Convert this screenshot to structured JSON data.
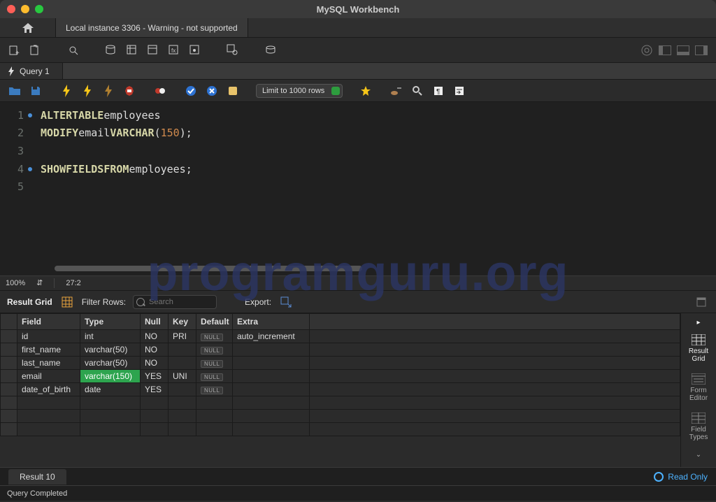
{
  "window": {
    "title": "MySQL Workbench"
  },
  "connection_tab": "Local instance 3306 - Warning - not supported",
  "query_tab": "Query 1",
  "limit_label": "Limit to 1000 rows",
  "editor": {
    "lines": [
      {
        "n": "1",
        "dot": true
      },
      {
        "n": "2",
        "dot": false
      },
      {
        "n": "3",
        "dot": false
      },
      {
        "n": "4",
        "dot": true
      },
      {
        "n": "5",
        "dot": false
      }
    ],
    "sql": {
      "l1_kw1": "ALTER",
      "l1_kw2": "TABLE",
      "l1_id": "employees",
      "l2_kw1": "MODIFY",
      "l2_id1": "email",
      "l2_kw2": "VARCHAR",
      "l2_num": "150",
      "l4_kw1": "SHOW",
      "l4_kw2": "FIELDS",
      "l4_kw3": "FROM",
      "l4_id": "employees"
    }
  },
  "zoom": "100%",
  "cursor_pos": "27:2",
  "result_toolbar": {
    "title": "Result Grid",
    "filter_label": "Filter Rows:",
    "search_placeholder": "Search",
    "export_label": "Export:"
  },
  "columns": [
    "Field",
    "Type",
    "Null",
    "Key",
    "Default",
    "Extra"
  ],
  "col_widths": [
    "90px",
    "86px",
    "40px",
    "40px",
    "52px",
    "110px",
    "auto"
  ],
  "rows": [
    {
      "Field": "id",
      "Type": "int",
      "Null": "NO",
      "Key": "PRI",
      "Default": "NULL",
      "Extra": "auto_increment",
      "hl": false
    },
    {
      "Field": "first_name",
      "Type": "varchar(50)",
      "Null": "NO",
      "Key": "",
      "Default": "NULL",
      "Extra": "",
      "hl": false
    },
    {
      "Field": "last_name",
      "Type": "varchar(50)",
      "Null": "NO",
      "Key": "",
      "Default": "NULL",
      "Extra": "",
      "hl": false
    },
    {
      "Field": "email",
      "Type": "varchar(150)",
      "Null": "YES",
      "Key": "UNI",
      "Default": "NULL",
      "Extra": "",
      "hl": true
    },
    {
      "Field": "date_of_birth",
      "Type": "date",
      "Null": "YES",
      "Key": "",
      "Default": "NULL",
      "Extra": "",
      "hl": false
    }
  ],
  "null_label": "NULL",
  "side_panel": [
    {
      "label_l1": "Result",
      "label_l2": "Grid",
      "active": true
    },
    {
      "label_l1": "Form",
      "label_l2": "Editor",
      "active": false
    },
    {
      "label_l1": "Field",
      "label_l2": "Types",
      "active": false
    }
  ],
  "result_tab": "Result 10",
  "readonly_label": "Read Only",
  "status": "Query Completed",
  "watermark": "programguru.org"
}
